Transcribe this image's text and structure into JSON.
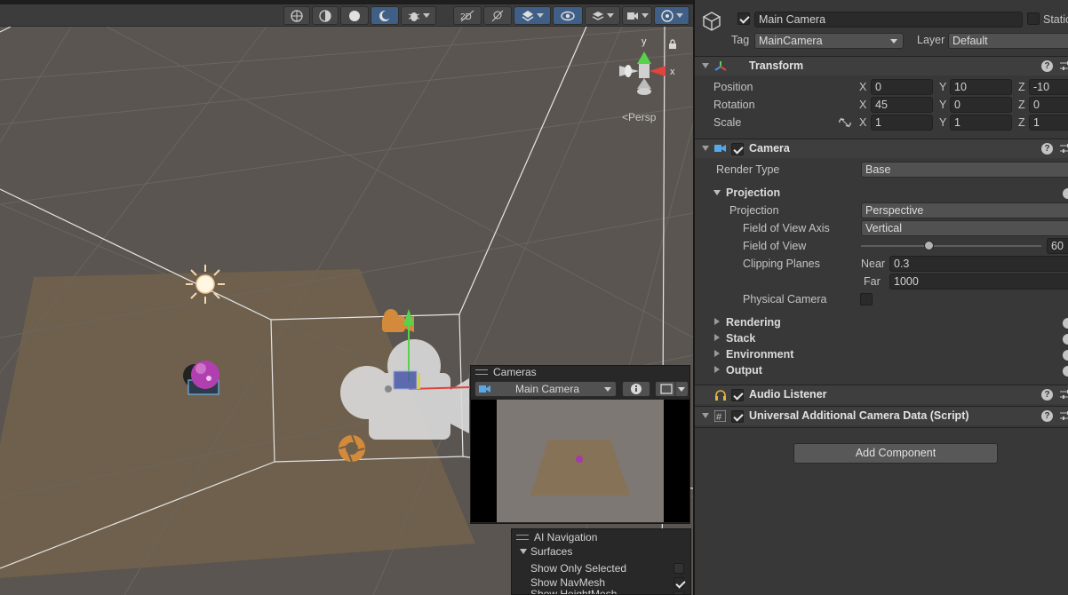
{
  "scene": {
    "persp_label": "Persp",
    "gizmo_axes": {
      "x": "x",
      "y": "y"
    }
  },
  "cameras_overlay": {
    "title": "Cameras",
    "selected_camera": "Main Camera"
  },
  "ai_navigation": {
    "title": "AI Navigation",
    "section": "Surfaces",
    "rows": [
      {
        "label": "Show Only Selected",
        "checked": false
      },
      {
        "label": "Show NavMesh",
        "checked": true
      },
      {
        "label": "Show HeightMesh",
        "checked": false
      }
    ]
  },
  "inspector": {
    "object_name": "Main Camera",
    "static_label": "Static",
    "tag_label": "Tag",
    "tag_value": "MainCamera",
    "layer_label": "Layer",
    "layer_value": "Default",
    "transform": {
      "title": "Transform",
      "position_label": "Position",
      "rotation_label": "Rotation",
      "scale_label": "Scale",
      "position": {
        "x": "0",
        "y": "10",
        "z": "-10"
      },
      "rotation": {
        "x": "45",
        "y": "0",
        "z": "0"
      },
      "scale": {
        "x": "1",
        "y": "1",
        "z": "1"
      }
    },
    "camera": {
      "title": "Camera",
      "render_type_label": "Render Type",
      "render_type_value": "Base",
      "projection_section": "Projection",
      "projection_label": "Projection",
      "projection_value": "Perspective",
      "fov_axis_label": "Field of View Axis",
      "fov_axis_value": "Vertical",
      "fov_label": "Field of View",
      "fov_value": "60",
      "fov_fraction": 0.375,
      "clipping_label": "Clipping Planes",
      "near_label": "Near",
      "near_value": "0.3",
      "far_label": "Far",
      "far_value": "1000",
      "physical_camera_label": "Physical Camera",
      "sections": [
        "Rendering",
        "Stack",
        "Environment",
        "Output"
      ]
    },
    "audio_listener": {
      "title": "Audio Listener"
    },
    "additional_data": {
      "title": "Universal Additional Camera Data (Script)"
    },
    "add_component_label": "Add Component",
    "help_glyph": "?",
    "colors": {
      "panel_bg": "#383838",
      "field_bg": "#2a2a2a",
      "accent_blue": "#3f5f86",
      "gizmo_green": "#58d24a",
      "gizmo_red": "#e0443c"
    }
  }
}
